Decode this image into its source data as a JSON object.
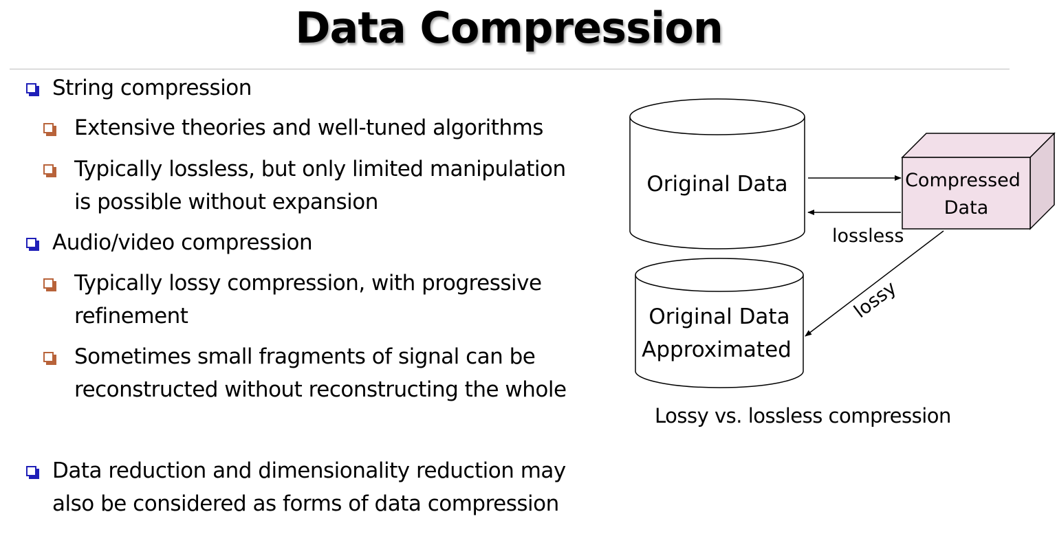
{
  "title": "Data Compression",
  "bullets": [
    {
      "level": 1,
      "lines": [
        "String compression"
      ]
    },
    {
      "level": 2,
      "lines": [
        "Extensive theories and well-tuned algorithms"
      ]
    },
    {
      "level": 2,
      "lines": [
        "Typically lossless, but only limited manipulation",
        "is possible without expansion"
      ]
    },
    {
      "level": 1,
      "lines": [
        "Audio/video compression"
      ]
    },
    {
      "level": 2,
      "lines": [
        "Typically lossy compression, with progressive",
        "refinement"
      ]
    },
    {
      "level": 2,
      "lines": [
        "Sometimes small fragments of signal can be",
        "reconstructed without reconstructing the whole"
      ]
    },
    {
      "level": 1,
      "lines": [
        "Data reduction and dimensionality reduction may",
        "also be considered as forms of data compression"
      ]
    }
  ],
  "diagram": {
    "original": "Original Data",
    "compressed": [
      "Compressed",
      "Data"
    ],
    "approximated": [
      "Original Data",
      "Approximated"
    ],
    "lossless_label": "lossless",
    "lossy_label": "lossy",
    "caption": "Lossy vs. lossless compression",
    "box_fill": "#f2dfe9"
  }
}
